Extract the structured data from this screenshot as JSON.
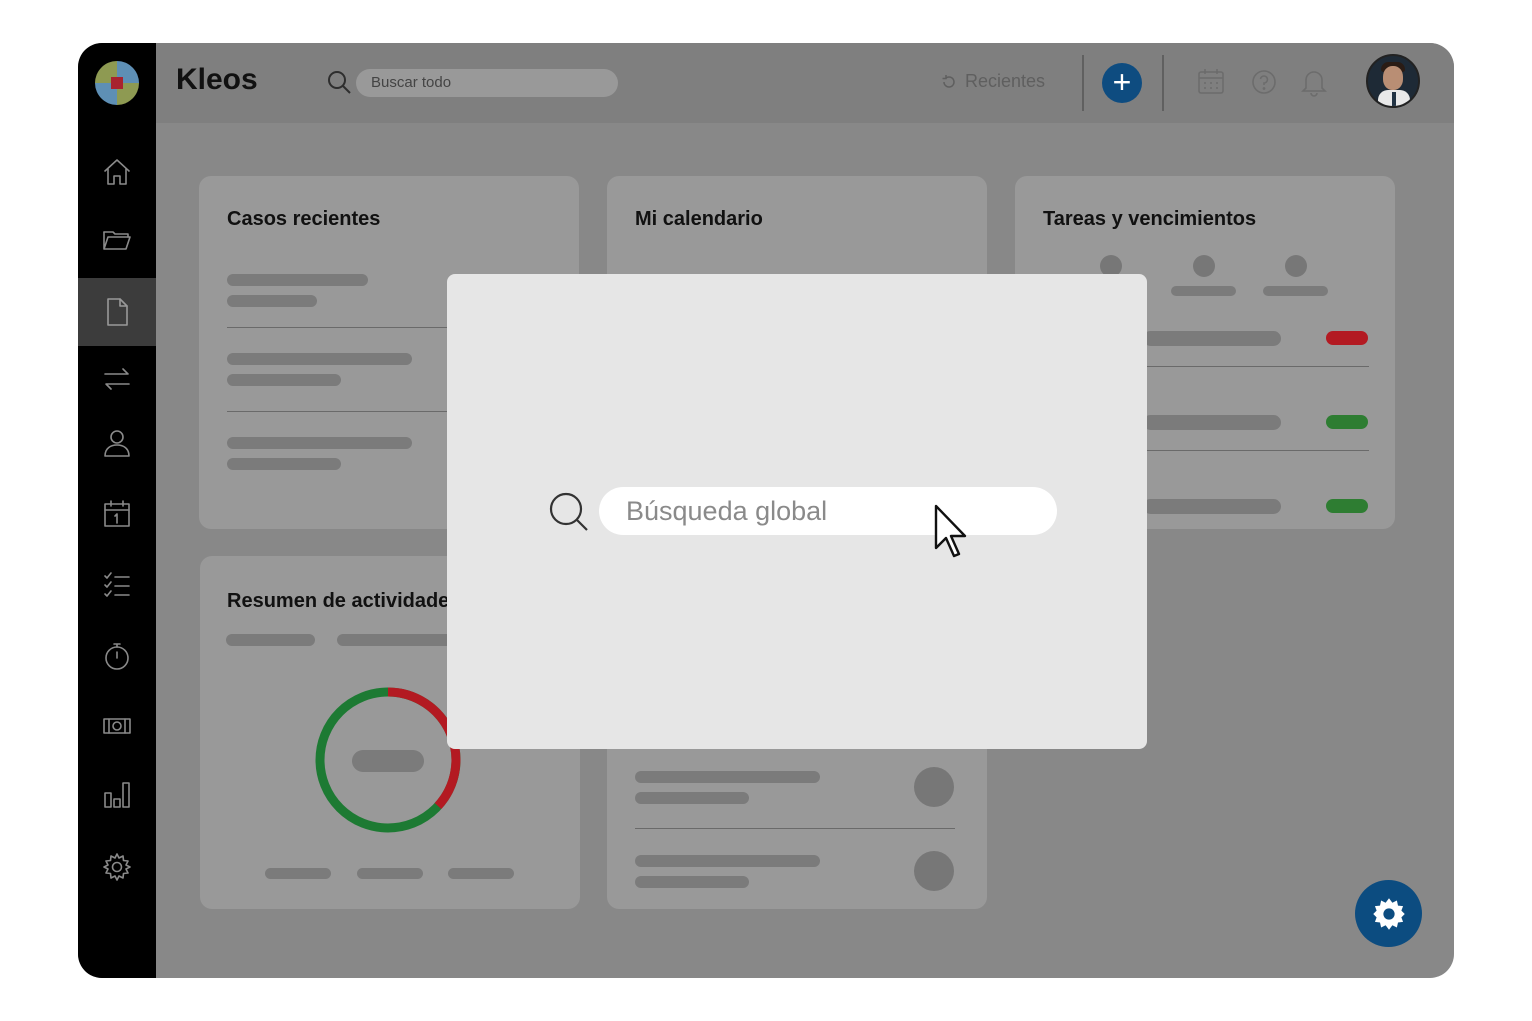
{
  "app": {
    "title": "Kleos"
  },
  "topbar": {
    "search_placeholder": "Buscar todo",
    "recents_label": "Recientes",
    "add_label": "+"
  },
  "sidebar": {
    "items": [
      {
        "name": "home",
        "icon": "home-icon"
      },
      {
        "name": "folders",
        "icon": "folder-icon"
      },
      {
        "name": "documents",
        "icon": "document-icon",
        "active": true
      },
      {
        "name": "transfers",
        "icon": "arrows-swap-icon"
      },
      {
        "name": "contacts",
        "icon": "person-icon"
      },
      {
        "name": "calendar",
        "icon": "calendar-icon"
      },
      {
        "name": "tasks",
        "icon": "checklist-icon"
      },
      {
        "name": "timer",
        "icon": "stopwatch-icon"
      },
      {
        "name": "billing",
        "icon": "money-icon"
      },
      {
        "name": "reports",
        "icon": "bar-chart-icon"
      },
      {
        "name": "settings",
        "icon": "gear-icon"
      }
    ]
  },
  "cards": {
    "recent_cases": {
      "title": "Casos recientes"
    },
    "calendar": {
      "title": "Mi calendario"
    },
    "tasks": {
      "title": "Tareas y vencimientos"
    },
    "activity": {
      "title": "Resumen de actividades"
    }
  },
  "modal": {
    "search_placeholder": "Búsqueda global"
  },
  "colors": {
    "accent": "#0e4c80",
    "status_red": "#b31a22",
    "status_green": "#2e7d32",
    "overlay": "#888888"
  }
}
